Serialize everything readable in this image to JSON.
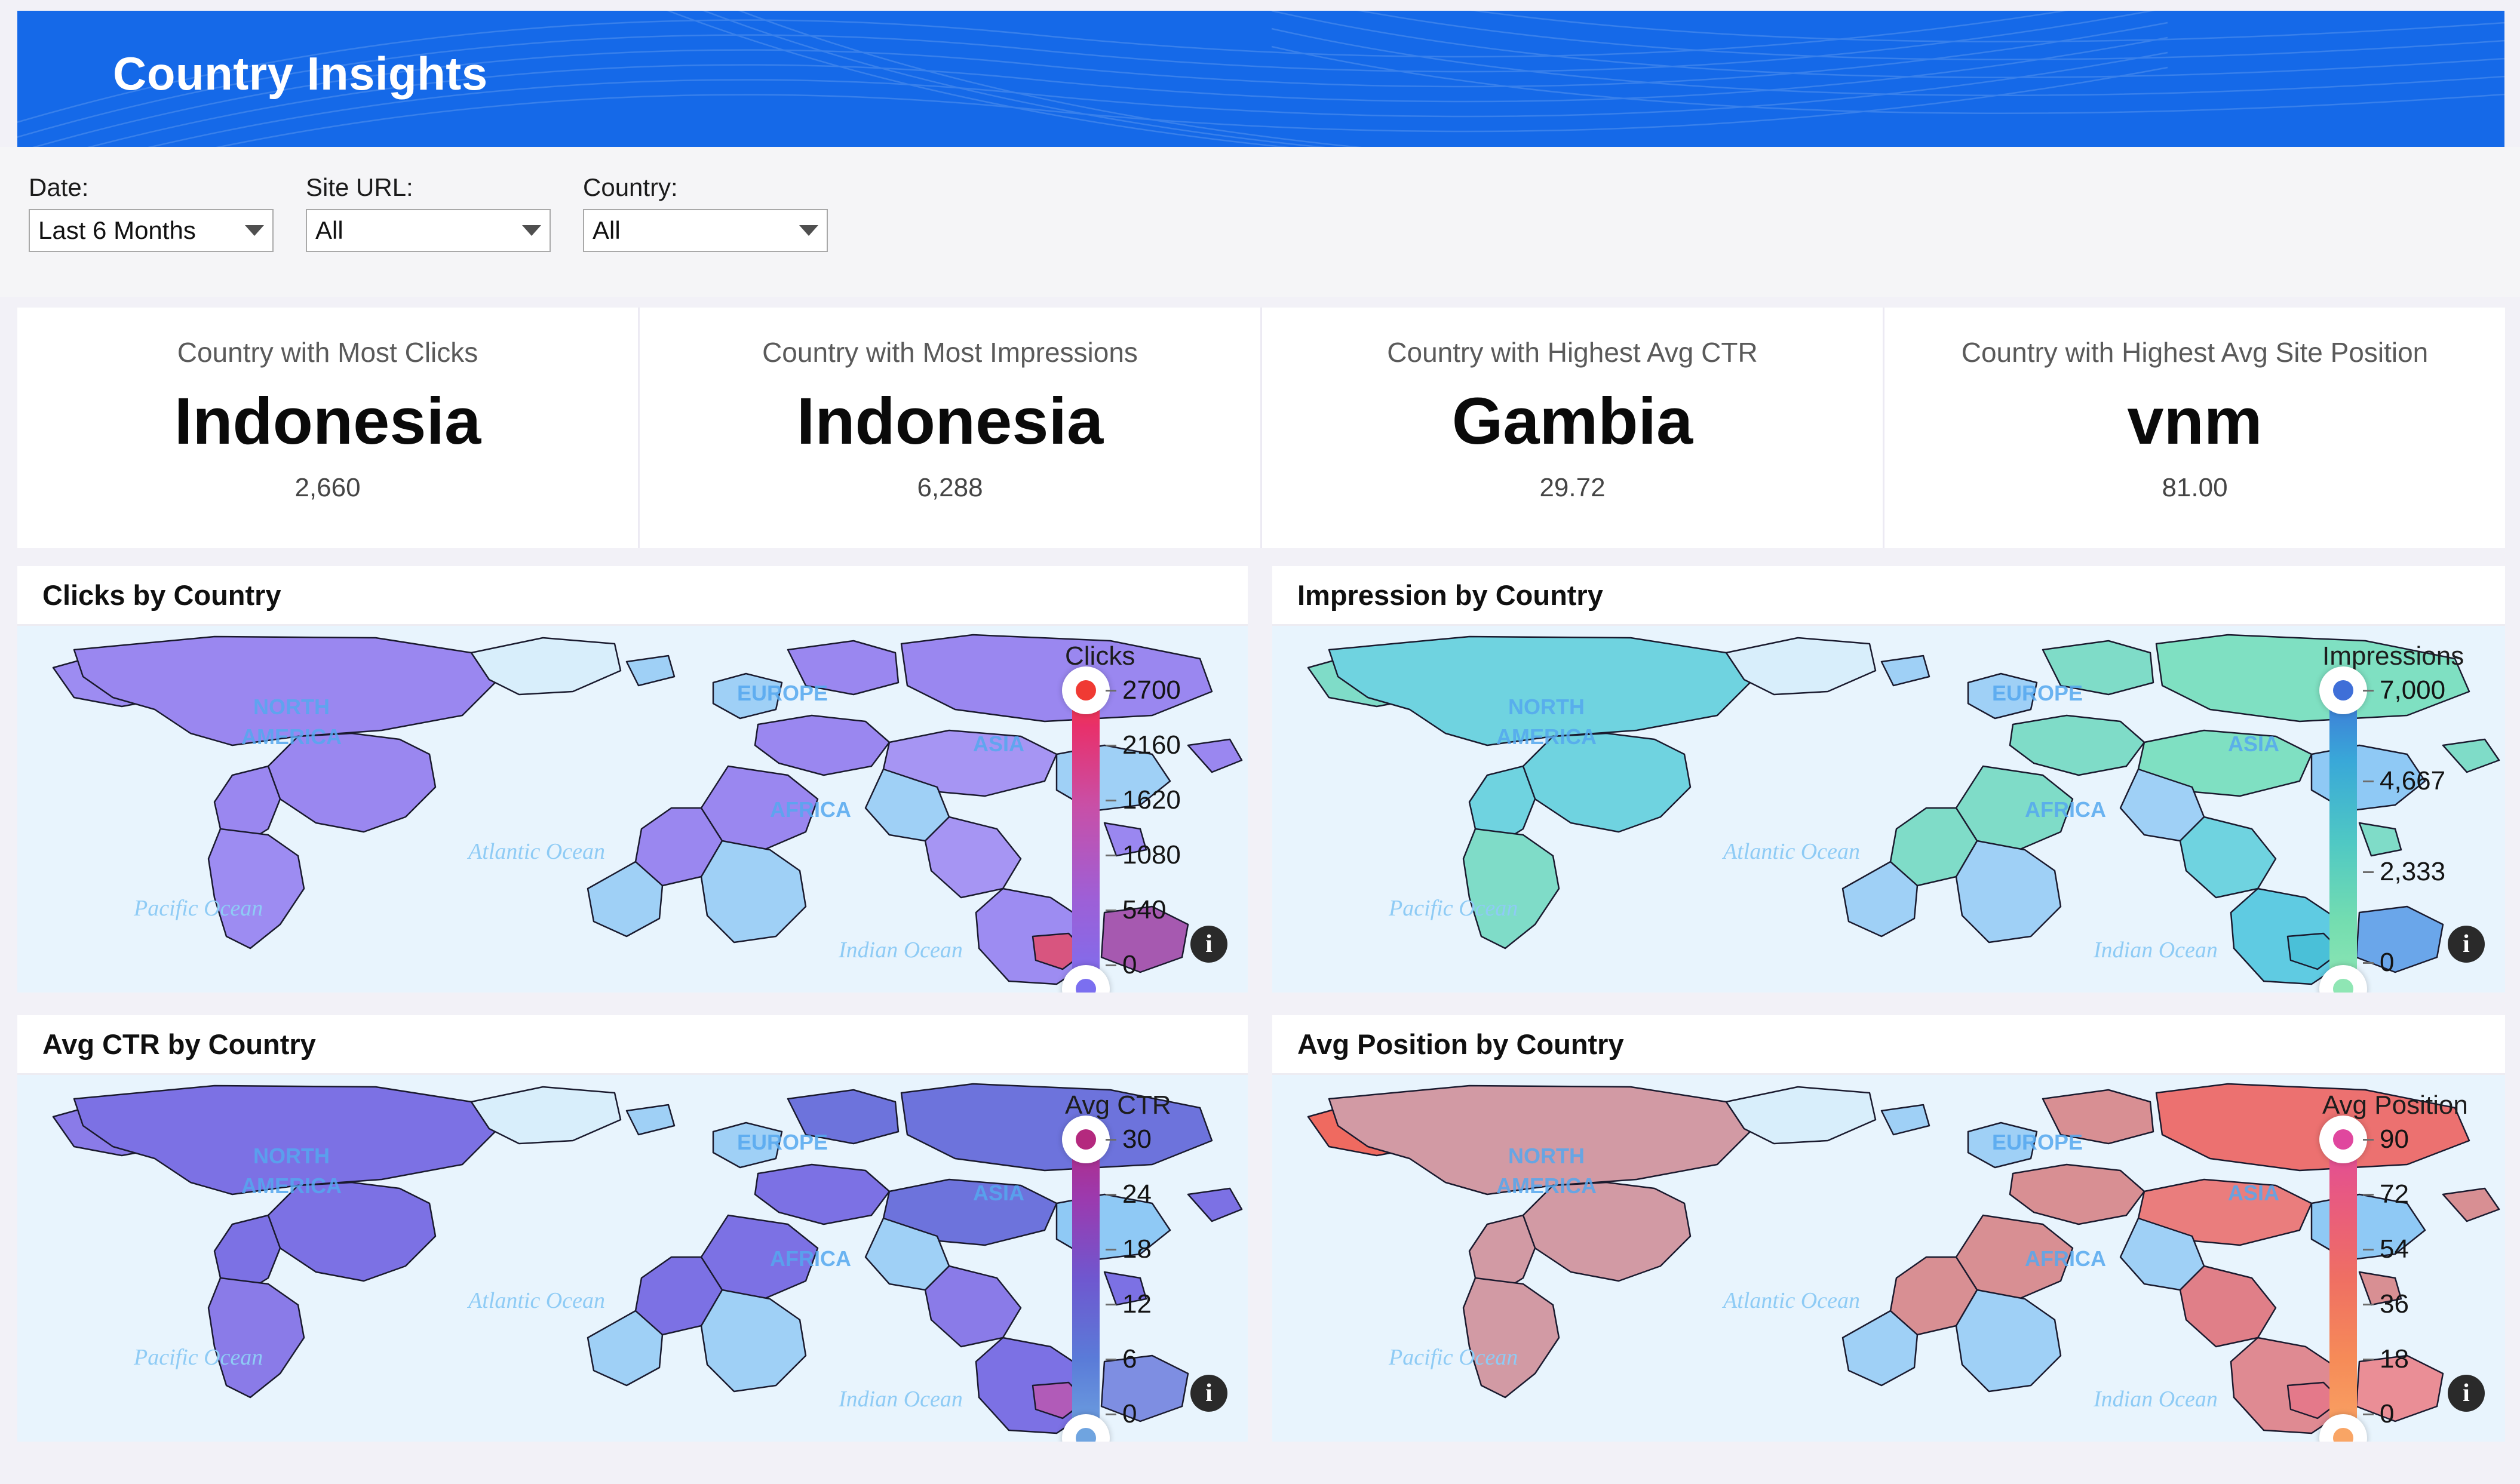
{
  "header": {
    "title": "Country Insights",
    "background_color": "#1569e8"
  },
  "filters": [
    {
      "name": "date",
      "label": "Date:",
      "value": "Last 6 Months"
    },
    {
      "name": "site_url",
      "label": "Site URL:",
      "value": "All"
    },
    {
      "name": "country",
      "label": "Country:",
      "value": "All"
    }
  ],
  "kpis": [
    {
      "title": "Country with Most Clicks",
      "value": "Indonesia",
      "sub": "2,660"
    },
    {
      "title": "Country with Most Impressions",
      "value": "Indonesia",
      "sub": "6,288"
    },
    {
      "title": "Country with Highest Avg CTR",
      "value": "Gambia",
      "sub": "29.72"
    },
    {
      "title": "Country with Highest Avg Site Position",
      "value": "vnm",
      "sub": "81.00"
    }
  ],
  "map_labels": {
    "north_america": "NORTH",
    "north_america2": "AMERICA",
    "europe": "EUROPE",
    "africa": "AFRICA",
    "asia": "ASIA",
    "pacific": "Pacific Ocean",
    "atlantic": "Atlantic Ocean",
    "indian": "Indian Ocean"
  },
  "panels": [
    {
      "title": "Clicks by Country",
      "legend_title": "Clicks"
    },
    {
      "title": "Impression by Country",
      "legend_title": "Impressions"
    },
    {
      "title": "Avg CTR by Country",
      "legend_title": "Avg CTR"
    },
    {
      "title": "Avg Position by Country",
      "legend_title": "Avg Position"
    }
  ],
  "chart_data": [
    {
      "type": "heatmap",
      "title": "Clicks by Country",
      "legend_title": "Clicks",
      "metric": "Clicks",
      "colorscale": [
        "#7b6ff0",
        "#9e5fd6",
        "#c94fa6",
        "#e8306b",
        "#f03a33"
      ],
      "ticks": [
        "2700",
        "2160",
        "1620",
        "1080",
        "540",
        "0"
      ],
      "tick_values": [
        2700,
        2160,
        1620,
        1080,
        540,
        0
      ],
      "range": [
        0,
        2700
      ],
      "max_country": "Indonesia",
      "max_value": 2660
    },
    {
      "type": "heatmap",
      "title": "Impression by Country",
      "legend_title": "Impressions",
      "metric": "Impressions",
      "colorscale": [
        "#3f6fd8",
        "#39a8d8",
        "#4fc8c4",
        "#74ddb0",
        "#8fe6b4"
      ],
      "ticks": [
        "7,000",
        "4,667",
        "2,333",
        "0"
      ],
      "tick_values": [
        7000,
        4667,
        2333,
        0
      ],
      "range": [
        0,
        7000
      ],
      "max_country": "Indonesia",
      "max_value": 6288
    },
    {
      "type": "heatmap",
      "title": "Avg CTR by Country",
      "legend_title": "Avg CTR",
      "metric": "Avg CTR",
      "colorscale": [
        "#b4297e",
        "#9c3aae",
        "#6f57cf",
        "#5a7bd8",
        "#6fa4e0"
      ],
      "ticks": [
        "30",
        "24",
        "18",
        "12",
        "6",
        "0"
      ],
      "tick_values": [
        30,
        24,
        18,
        12,
        6,
        0
      ],
      "range": [
        0,
        30
      ],
      "max_country": "Gambia",
      "max_value": 29.72
    },
    {
      "type": "heatmap",
      "title": "Avg Position by Country",
      "legend_title": "Avg Position",
      "metric": "Avg Position",
      "colorscale": [
        "#e0479e",
        "#e85a80",
        "#ef6f63",
        "#f68b58",
        "#f9a565"
      ],
      "ticks": [
        "90",
        "72",
        "54",
        "36",
        "18",
        "0"
      ],
      "tick_values": [
        90,
        72,
        54,
        36,
        18,
        0
      ],
      "range": [
        0,
        90
      ],
      "max_country": "vnm",
      "max_value": 81.0
    }
  ]
}
